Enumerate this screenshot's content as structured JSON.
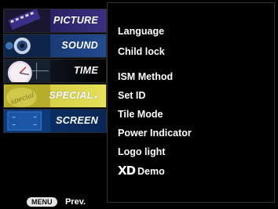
{
  "sidebar": {
    "tabs": [
      {
        "label": "PICTURE"
      },
      {
        "label": "SOUND"
      },
      {
        "label": "TIME"
      },
      {
        "label": "SPECIAL",
        "selected": true,
        "indicator": "▸"
      },
      {
        "label": "SCREEN"
      }
    ],
    "thumb_text": "special"
  },
  "menu": {
    "items": [
      "Language",
      "Child lock",
      "ISM Method",
      "Set ID",
      "Tile Mode",
      "Power Indicator",
      "Logo light"
    ],
    "xd_logo": "XD",
    "xd_label": "Demo"
  },
  "footer": {
    "menu_key": "MENU",
    "prev_label": "Prev."
  },
  "colors": {
    "selected_tab": "#d8d248",
    "text": "#ffffff",
    "background": "#000000"
  }
}
